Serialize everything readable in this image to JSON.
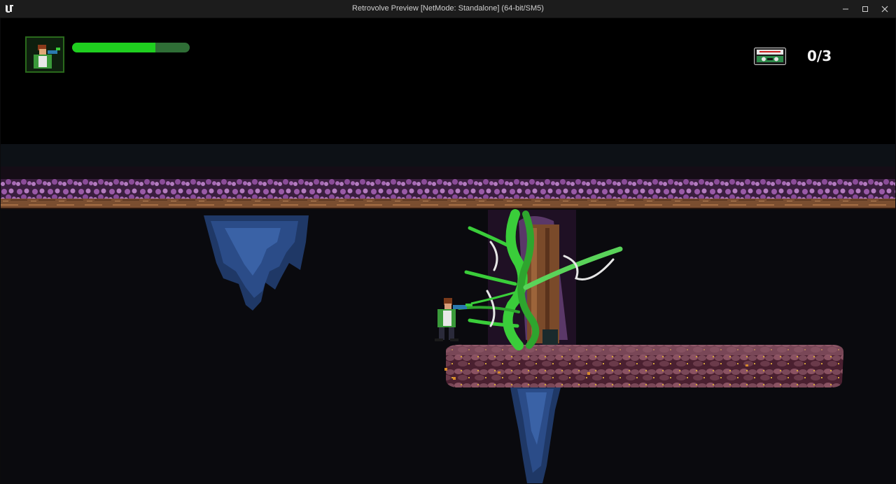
{
  "window": {
    "title": "Retrovolve Preview [NetMode: Standalone]  (64-bit/SM5)",
    "controls": [
      "minimize",
      "maximize",
      "close"
    ]
  },
  "hud": {
    "health_fraction": 0.71,
    "health_color": "#1fcf1f",
    "health_track_color": "#2f6e36",
    "collectibles_counter": "0/3",
    "collectible_icon": "cassette-tape-icon",
    "portrait_icon": "player-portrait-icon"
  },
  "colors": {
    "titlebar": "#1c1c1c",
    "ceiling_rocks": "#9a5aa8",
    "ceiling_beam": "#8a5a36",
    "platform": "#7a4858",
    "vines": "#3acd3a",
    "stalactites": "#2a4e86"
  }
}
